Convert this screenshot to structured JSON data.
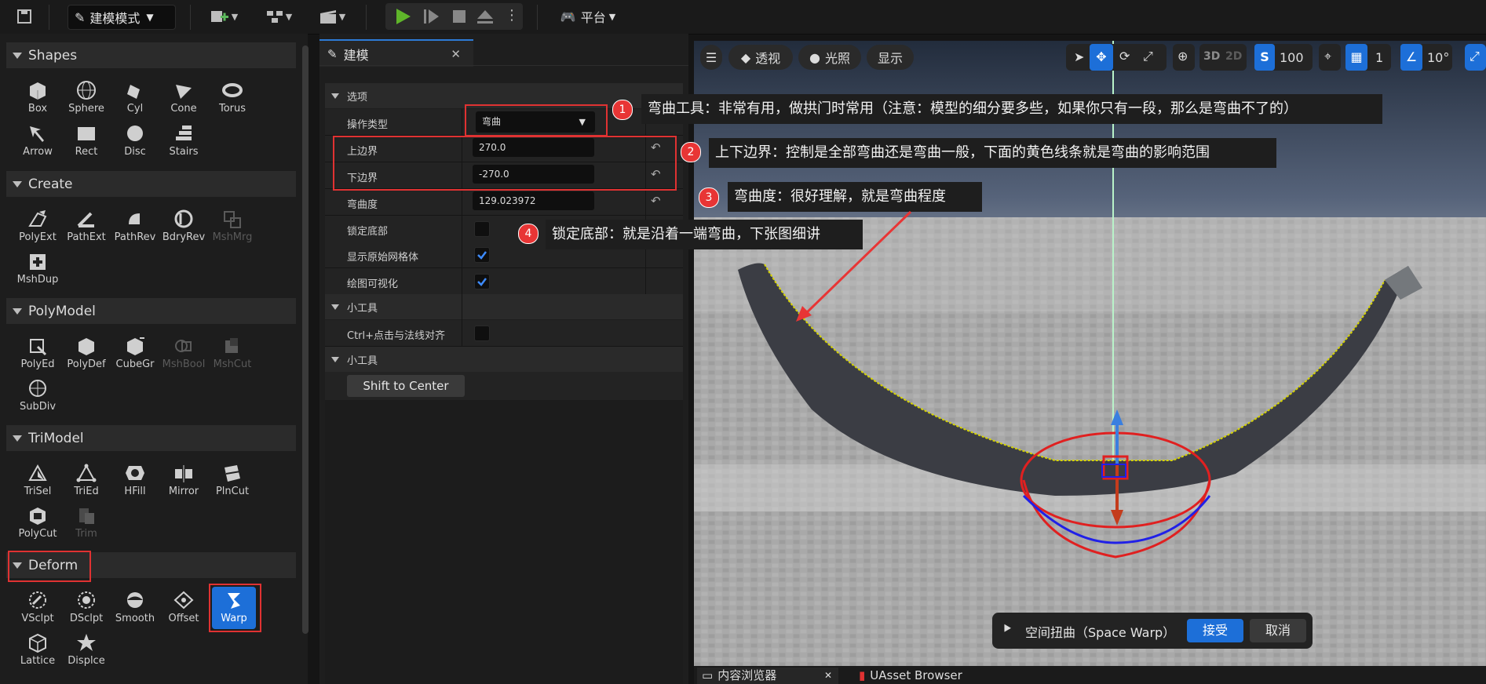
{
  "toolbar": {
    "mode_label": "建模模式",
    "platform_label": "平台"
  },
  "palette": {
    "sections": {
      "shapes": "Shapes",
      "create": "Create",
      "polymodel": "PolyModel",
      "trimodel": "TriModel",
      "deform": "Deform"
    },
    "shapes": [
      "Box",
      "Sphere",
      "Cyl",
      "Cone",
      "Torus",
      "Arrow",
      "Rect",
      "Disc",
      "Stairs"
    ],
    "create": [
      "PolyExt",
      "PathExt",
      "PathRev",
      "BdryRev",
      "MshMrg",
      "MshDup"
    ],
    "polymodel": [
      "PolyEd",
      "PolyDef",
      "CubeGr",
      "MshBool",
      "MshCut",
      "SubDiv"
    ],
    "trimodel": [
      "TriSel",
      "TriEd",
      "HFill",
      "Mirror",
      "PlnCut",
      "PolyCut",
      "Trim"
    ],
    "deform": [
      "VSclpt",
      "DSclpt",
      "Smooth",
      "Offset",
      "Warp",
      "Lattice",
      "Displce"
    ]
  },
  "details": {
    "tab_label": "建模",
    "section_options": "选项",
    "op_type_label": "操作类型",
    "op_type_value": "弯曲",
    "upper_label": "上边界",
    "upper_value": "270.0",
    "lower_label": "下边界",
    "lower_value": "-270.0",
    "bend_label": "弯曲度",
    "bend_value": "129.023972",
    "lock_label": "锁定底部",
    "show_orig_label": "显示原始网格体",
    "draw_vis_label": "绘图可视化",
    "section_tools1": "小工具",
    "ctrl_label": "Ctrl+点击与法线对齐",
    "section_tools2": "小工具",
    "shift_label": "Shift to Center"
  },
  "viewport": {
    "perspective_label": "透视",
    "lit_label": "光照",
    "show_label": "显示",
    "mode_3d": "3D",
    "mode_2d": "2D",
    "cam_speed": "100",
    "grid_value": "1",
    "rot_snap": "10°"
  },
  "callouts": [
    {
      "num": "1",
      "text": "弯曲工具：非常有用，做拱门时常用（注意：模型的细分要多些，如果你只有一段，那么是弯曲不了的）"
    },
    {
      "num": "2",
      "text": "上下边界：控制是全部弯曲还是弯曲一般，下面的黄色线条就是弯曲的影响范围"
    },
    {
      "num": "3",
      "text": "弯曲度：很好理解，就是弯曲程度"
    },
    {
      "num": "4",
      "text": "锁定底部：就是沿着一端弯曲，下张图细讲"
    }
  ],
  "accept_bar": {
    "title": "空间扭曲（Space Warp）",
    "accept": "接受",
    "cancel": "取消"
  },
  "bottom_tabs": {
    "content_browser": "内容浏览器",
    "uasset": "UAsset Browser"
  },
  "colors": {
    "accent": "#1d6fd8",
    "highlight_red": "#e03232",
    "panel_bg": "#1e1e1e"
  }
}
